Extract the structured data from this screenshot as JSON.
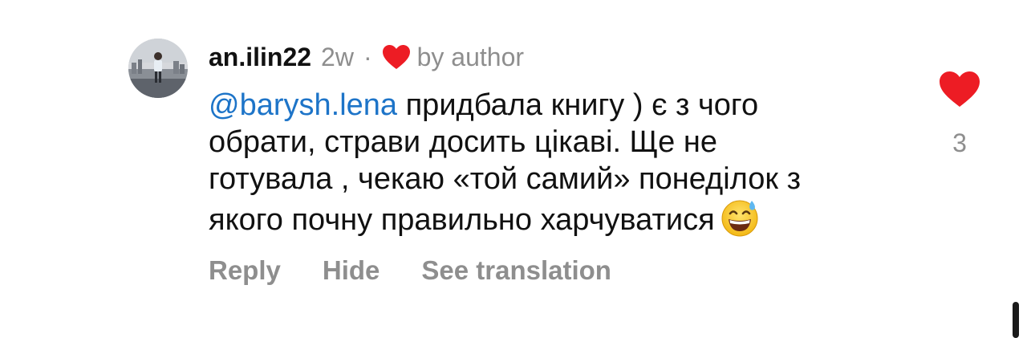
{
  "comment": {
    "username": "an.ilin22",
    "time": "2w",
    "separator": "·",
    "author_badge_text": "by author",
    "mention": "@barysh.lena",
    "text_line1": " придбала книгу ) є з чого",
    "text_line2": "обрати, страви досить цікаві. Ще не",
    "text_line3": "готувала , чекаю «той самий» понеділок з",
    "text_line4": "якого почну правильно харчуватися",
    "emoji": "grinning-face-with-sweat-emoji",
    "like_count": "3"
  },
  "actions": {
    "reply": "Reply",
    "hide": "Hide",
    "see_translation": "See translation"
  },
  "colors": {
    "mention": "#1d74c8",
    "heart": "#ed1c24",
    "muted": "#8e8e8e"
  }
}
